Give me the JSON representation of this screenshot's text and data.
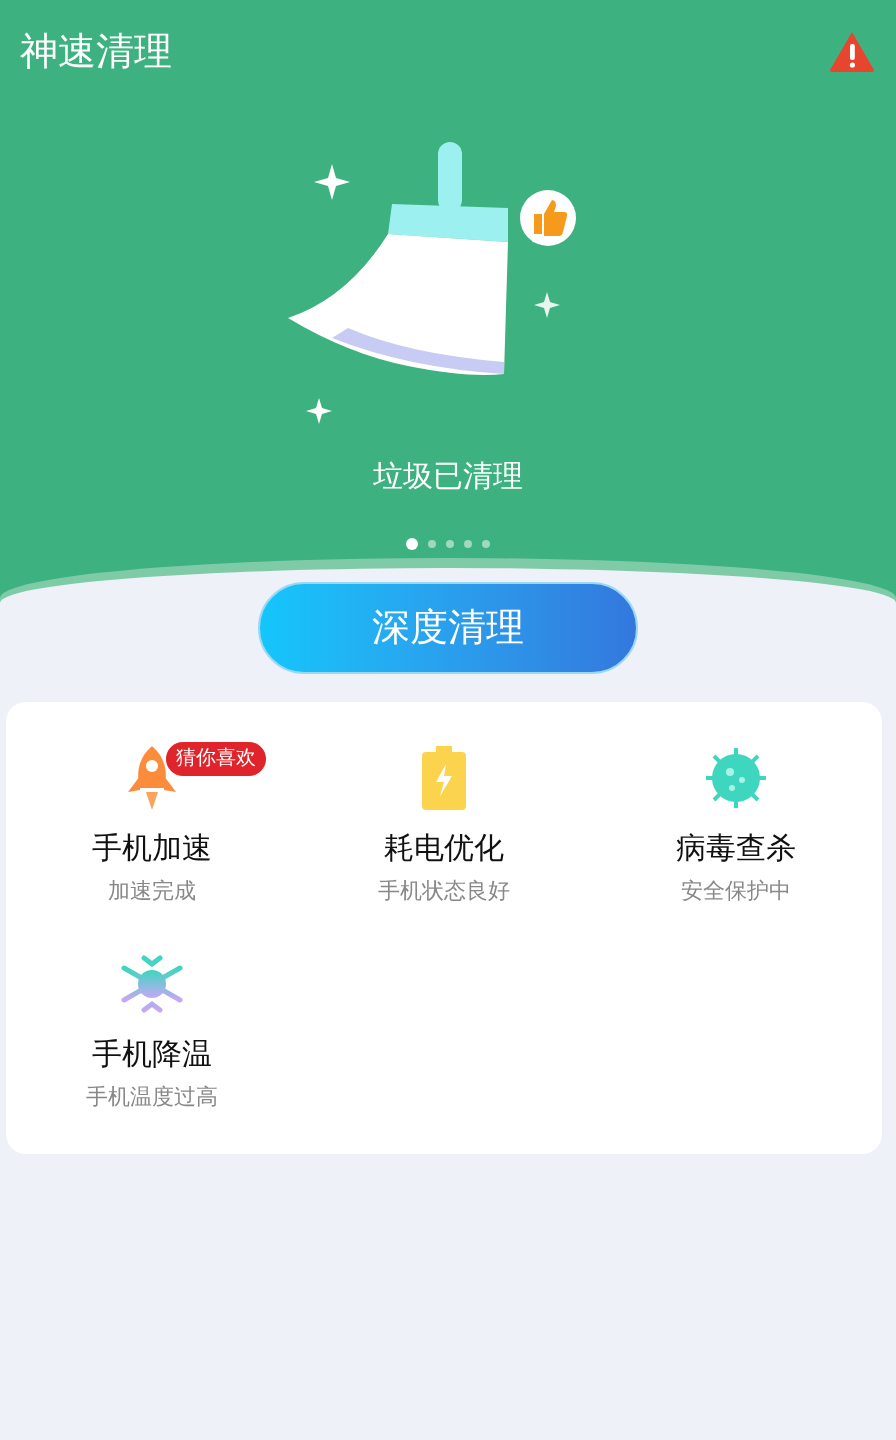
{
  "header": {
    "title": "神速清理",
    "alert": true
  },
  "hero": {
    "status": "垃圾已清理",
    "pages": [
      {
        "selected": true
      },
      {
        "selected": false
      },
      {
        "selected": false
      },
      {
        "selected": false
      },
      {
        "selected": false
      }
    ]
  },
  "action_button": "深度清理",
  "tools": [
    {
      "kind": "rocket",
      "title": "手机加速",
      "subtitle": "加速完成",
      "badge": "猜你喜欢"
    },
    {
      "kind": "battery",
      "title": "耗电优化",
      "subtitle": "手机状态良好"
    },
    {
      "kind": "virus",
      "title": "病毒查杀",
      "subtitle": "安全保护中"
    },
    {
      "kind": "snowflake",
      "title": "手机降温",
      "subtitle": "手机温度过高"
    }
  ]
}
